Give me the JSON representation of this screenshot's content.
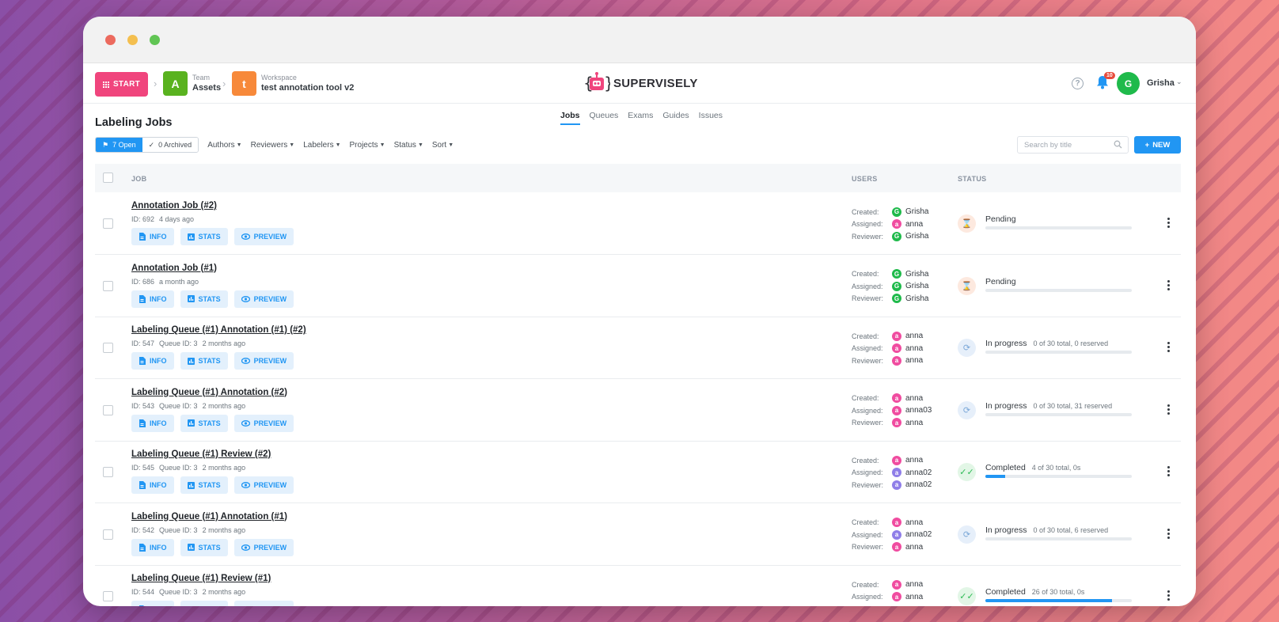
{
  "window": {
    "controls": [
      "close",
      "minimize",
      "maximize"
    ]
  },
  "topnav": {
    "start_label": "START",
    "team": {
      "initial": "A",
      "small": "Team",
      "name": "Assets",
      "color": "#59b21f"
    },
    "workspace": {
      "initial": "t",
      "small": "Workspace",
      "name": "test annotation tool v2",
      "color": "#f7893a"
    },
    "logo_text": "SUPERVISELY",
    "notifications_count": "10",
    "user": {
      "initial": "G",
      "name": "Grisha"
    }
  },
  "page": {
    "title": "Labeling Jobs"
  },
  "tabs": [
    "Jobs",
    "Queues",
    "Exams",
    "Guides",
    "Issues"
  ],
  "filters": {
    "open_label": "7 Open",
    "archived_label": "0 Archived",
    "dropdowns": [
      "Authors",
      "Reviewers",
      "Labelers",
      "Projects",
      "Status",
      "Sort"
    ],
    "search_placeholder": "Search by title",
    "new_label": "NEW"
  },
  "table": {
    "headers": {
      "job": "JOB",
      "users": "USERS",
      "status": "STATUS"
    },
    "user_labels": {
      "created": "Created:",
      "assigned": "Assigned:",
      "reviewer": "Reviewer:"
    },
    "button_labels": {
      "info": "INFO",
      "stats": "STATS",
      "preview": "PREVIEW"
    },
    "rows": [
      {
        "title": "Annotation Job (#2)",
        "id": "ID: 692",
        "queue": "",
        "time": "4 days ago",
        "created": {
          "name": "Grisha",
          "initial": "G",
          "color": "#1fba4b"
        },
        "assigned": {
          "name": "anna",
          "initial": "a",
          "color": "#f04ca0"
        },
        "reviewer": {
          "name": "Grisha",
          "initial": "G",
          "color": "#1fba4b"
        },
        "status": "Pending",
        "status_sub": "",
        "progress": 0,
        "status_kind": "pending"
      },
      {
        "title": "Annotation Job (#1)",
        "id": "ID: 686",
        "queue": "",
        "time": "a month ago",
        "created": {
          "name": "Grisha",
          "initial": "G",
          "color": "#1fba4b"
        },
        "assigned": {
          "name": "Grisha",
          "initial": "G",
          "color": "#1fba4b"
        },
        "reviewer": {
          "name": "Grisha",
          "initial": "G",
          "color": "#1fba4b"
        },
        "status": "Pending",
        "status_sub": "",
        "progress": 0,
        "status_kind": "pending"
      },
      {
        "title": "Labeling Queue (#1) Annotation (#1) (#2)",
        "id": "ID: 547",
        "queue": "Queue ID: 3",
        "time": "2 months ago",
        "created": {
          "name": "anna",
          "initial": "a",
          "color": "#f04ca0"
        },
        "assigned": {
          "name": "anna",
          "initial": "a",
          "color": "#f04ca0"
        },
        "reviewer": {
          "name": "anna",
          "initial": "a",
          "color": "#f04ca0"
        },
        "status": "In progress",
        "status_sub": "0 of 30 total, 0 reserved",
        "progress": 0,
        "status_kind": "progress"
      },
      {
        "title": "Labeling Queue (#1) Annotation (#2)",
        "id": "ID: 543",
        "queue": "Queue ID: 3",
        "time": "2 months ago",
        "created": {
          "name": "anna",
          "initial": "a",
          "color": "#f04ca0"
        },
        "assigned": {
          "name": "anna03",
          "initial": "a",
          "color": "#f04ca0"
        },
        "reviewer": {
          "name": "anna",
          "initial": "a",
          "color": "#f04ca0"
        },
        "status": "In progress",
        "status_sub": "0 of 30 total, 31 reserved",
        "progress": 0,
        "status_kind": "progress"
      },
      {
        "title": "Labeling Queue (#1) Review (#2)",
        "id": "ID: 545",
        "queue": "Queue ID: 3",
        "time": "2 months ago",
        "created": {
          "name": "anna",
          "initial": "a",
          "color": "#f04ca0"
        },
        "assigned": {
          "name": "anna02",
          "initial": "a",
          "color": "#8f7ee8"
        },
        "reviewer": {
          "name": "anna02",
          "initial": "a",
          "color": "#8f7ee8"
        },
        "status": "Completed",
        "status_sub": "4 of 30 total, 0s",
        "progress": 0.133,
        "status_kind": "completed"
      },
      {
        "title": "Labeling Queue (#1) Annotation (#1)",
        "id": "ID: 542",
        "queue": "Queue ID: 3",
        "time": "2 months ago",
        "created": {
          "name": "anna",
          "initial": "a",
          "color": "#f04ca0"
        },
        "assigned": {
          "name": "anna02",
          "initial": "a",
          "color": "#8f7ee8"
        },
        "reviewer": {
          "name": "anna",
          "initial": "a",
          "color": "#f04ca0"
        },
        "status": "In progress",
        "status_sub": "0 of 30 total, 6 reserved",
        "progress": 0,
        "status_kind": "progress"
      },
      {
        "title": "Labeling Queue (#1) Review (#1)",
        "id": "ID: 544",
        "queue": "Queue ID: 3",
        "time": "2 months ago",
        "created": {
          "name": "anna",
          "initial": "a",
          "color": "#f04ca0"
        },
        "assigned": {
          "name": "anna",
          "initial": "a",
          "color": "#f04ca0"
        },
        "reviewer": {
          "name": "",
          "initial": "",
          "color": "#f04ca0"
        },
        "status": "Completed",
        "status_sub": "26 of 30 total, 0s",
        "progress": 0.867,
        "status_kind": "completed"
      }
    ]
  },
  "colors": {
    "accent": "#2196f3",
    "start": "#f0457d"
  }
}
